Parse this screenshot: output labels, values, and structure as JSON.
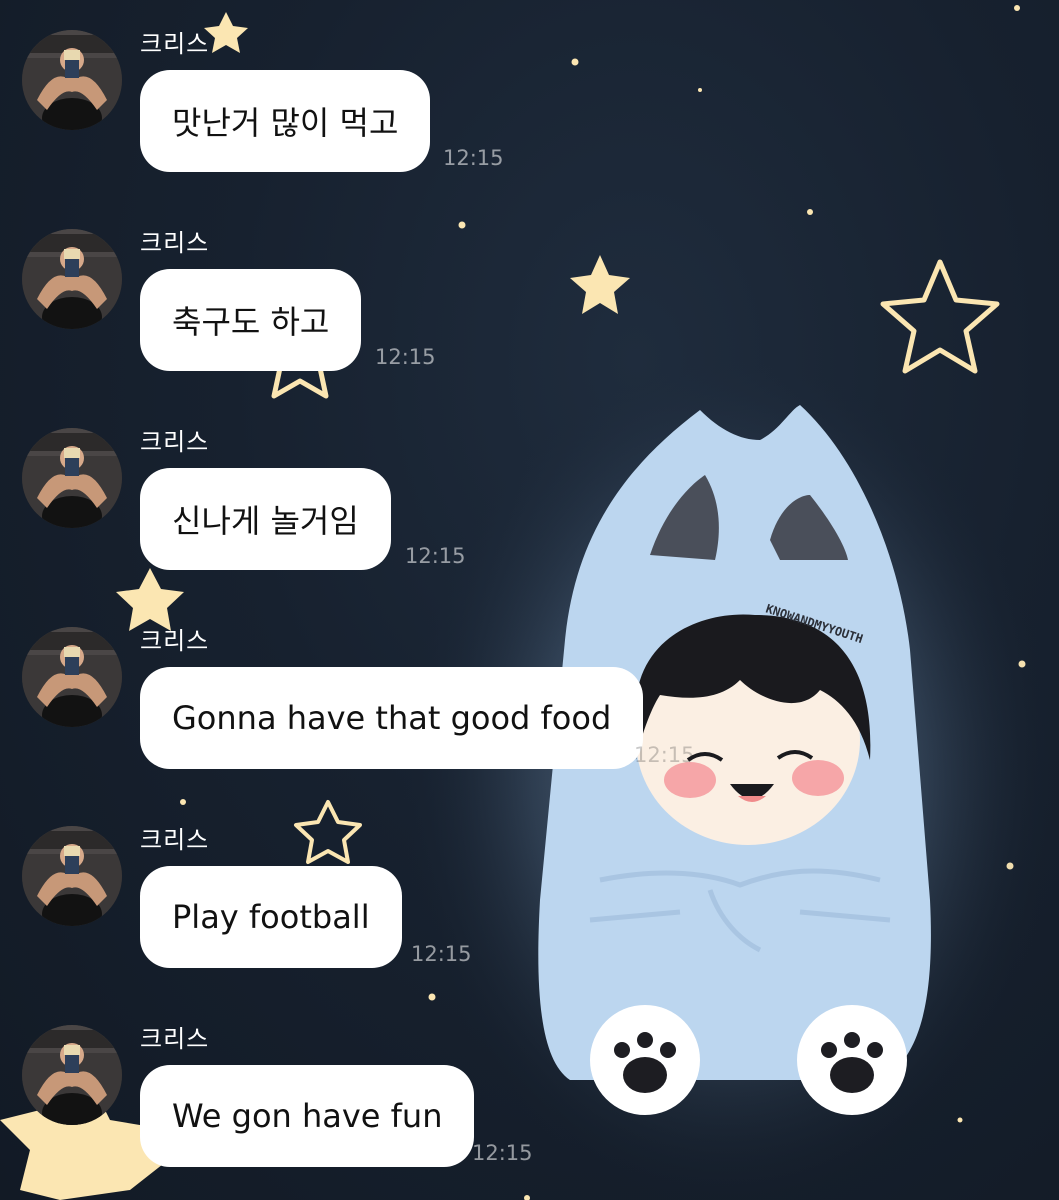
{
  "chat": {
    "messages": [
      {
        "sender": "크리스",
        "text": "맛난거 많이 먹고",
        "time": "12:15"
      },
      {
        "sender": "크리스",
        "text": "축구도 하고",
        "time": "12:15"
      },
      {
        "sender": "크리스",
        "text": "신나게 놀거임",
        "time": "12:15"
      },
      {
        "sender": "크리스",
        "text": "Gonna have that good food",
        "time": "12:15"
      },
      {
        "sender": "크리스",
        "text": "Play football",
        "time": "12:15"
      },
      {
        "sender": "크리스",
        "text": "We gon have fun",
        "time": "12:15"
      }
    ]
  },
  "wallpaper": {
    "watermark": "KNOWANDMYYOUTH"
  },
  "colors": {
    "background": "#17212f",
    "bubble": "#ffffff",
    "timestamp": "#8a949f",
    "star": "#fbe6b2",
    "hoodie": "#bcd6ef"
  }
}
